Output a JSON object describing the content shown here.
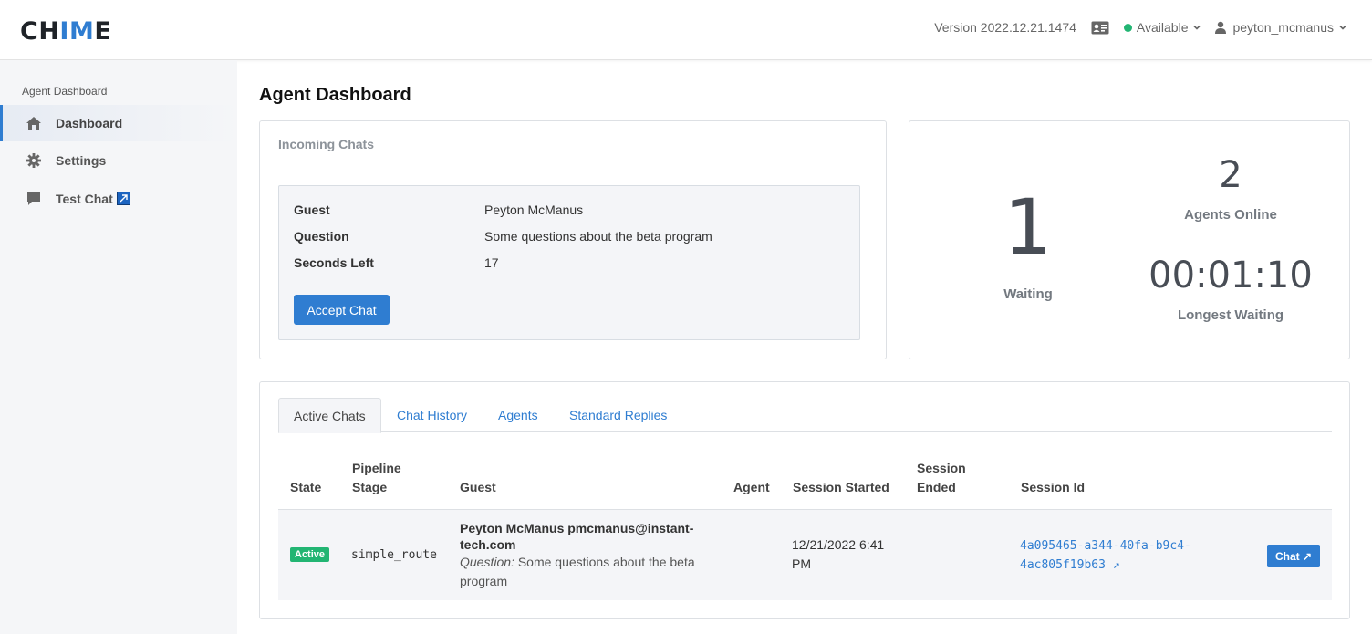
{
  "header": {
    "logo_text": "CHIME",
    "version": "Version 2022.12.21.1474",
    "status": "Available",
    "status_color": "#22b573",
    "username": "peyton_mcmanus"
  },
  "sidebar": {
    "section_title": "Agent Dashboard",
    "items": [
      {
        "label": "Dashboard",
        "icon": "home-icon",
        "active": true
      },
      {
        "label": "Settings",
        "icon": "gear-icon",
        "active": false
      },
      {
        "label": "Test Chat",
        "icon": "chat-bubble-icon",
        "active": false,
        "external": true
      }
    ]
  },
  "page": {
    "title": "Agent Dashboard"
  },
  "incoming": {
    "title": "Incoming Chats",
    "rows": [
      {
        "label": "Guest",
        "value": "Peyton McManus"
      },
      {
        "label": "Question",
        "value": "Some questions about the beta program"
      },
      {
        "label": "Seconds Left",
        "value": "17"
      }
    ],
    "accept_label": "Accept Chat"
  },
  "stats": {
    "waiting_value": "1",
    "waiting_label": "Waiting",
    "agents_online_value": "2",
    "agents_online_label": "Agents Online",
    "longest_waiting_value": "00:01:10",
    "longest_waiting_label": "Longest Waiting"
  },
  "chats": {
    "tabs": [
      "Active Chats",
      "Chat History",
      "Agents",
      "Standard Replies"
    ],
    "active_tab": "Active Chats",
    "columns": {
      "state": "State",
      "pipeline_1": "Pipeline",
      "pipeline_2": "Stage",
      "guest": "Guest",
      "agent": "Agent",
      "started": "Session Started",
      "ended_1": "Session",
      "ended_2": "Ended",
      "session_id": "Session Id"
    },
    "rows": [
      {
        "state": "Active",
        "pipeline_stage": "simple_route",
        "guest_line1": "Peyton McManus pmcmanus@instant-",
        "guest_line2": "tech.com",
        "question_prefix": "Question:",
        "question_line1": "Some questions about the beta",
        "question_line2": "program",
        "agent": "",
        "started_line1": "12/21/2022 6:41",
        "started_line2": "PM",
        "ended": "",
        "session_id_line1": "4a095465-a344-40fa-b9c4-",
        "session_id_line2": "4ac805f19b63 ↗",
        "chat_button": "Chat ↗"
      }
    ]
  },
  "colors": {
    "accent": "#2f7dd1",
    "success": "#22b573"
  }
}
